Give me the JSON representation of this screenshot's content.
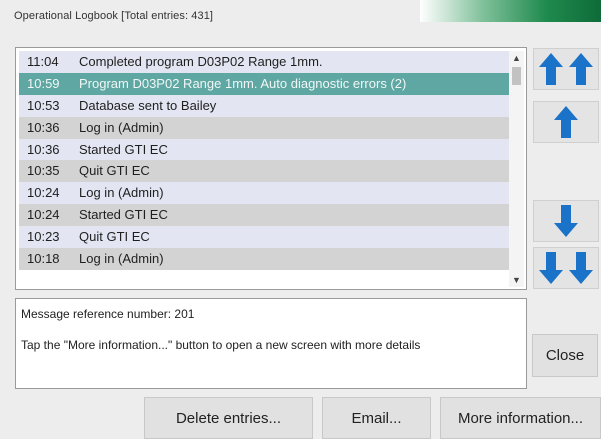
{
  "window": {
    "title": "Operational Logbook  [Total entries: 431]"
  },
  "log": {
    "entries": [
      {
        "time": "11:04",
        "text": "Completed program D03P02 Range 1mm.",
        "selected": false
      },
      {
        "time": "10:59",
        "text": "Program D03P02 Range 1mm. Auto diagnostic errors (2)",
        "selected": true
      },
      {
        "time": "10:53",
        "text": "Database sent to Bailey",
        "selected": false
      },
      {
        "time": "10:36",
        "text": "Log in (Admin)",
        "selected": false
      },
      {
        "time": "10:36",
        "text": "Started GTI EC",
        "selected": false
      },
      {
        "time": "10:35",
        "text": "Quit GTI EC",
        "selected": false
      },
      {
        "time": "10:24",
        "text": "Log in (Admin)",
        "selected": false
      },
      {
        "time": "10:24",
        "text": "Started GTI EC",
        "selected": false
      },
      {
        "time": "10:23",
        "text": "Quit GTI EC",
        "selected": false
      },
      {
        "time": "10:18",
        "text": "Log in (Admin)",
        "selected": false
      }
    ],
    "scroll_up_glyph": "▲",
    "scroll_down_glyph": "▼"
  },
  "nav": {
    "arrow_color": "#1a73c8",
    "buttons": [
      {
        "name": "scroll-to-top-button",
        "icon": "double-arrow-up-icon"
      },
      {
        "name": "scroll-up-button",
        "icon": "arrow-up-icon"
      },
      {
        "name": "scroll-down-button",
        "icon": "arrow-down-icon"
      },
      {
        "name": "scroll-to-bottom-button",
        "icon": "double-arrow-down-icon"
      }
    ]
  },
  "message": {
    "reference": "Message reference number: 201",
    "info": "Tap the \"More information...\" button to open a new screen with more details"
  },
  "buttons": {
    "close": "Close",
    "delete": "Delete entries...",
    "email": "Email...",
    "more": "More information..."
  },
  "colors": {
    "row_odd": "#e3e6f2",
    "row_even": "#d3d3d3",
    "row_selected": "#5fa7a3"
  }
}
